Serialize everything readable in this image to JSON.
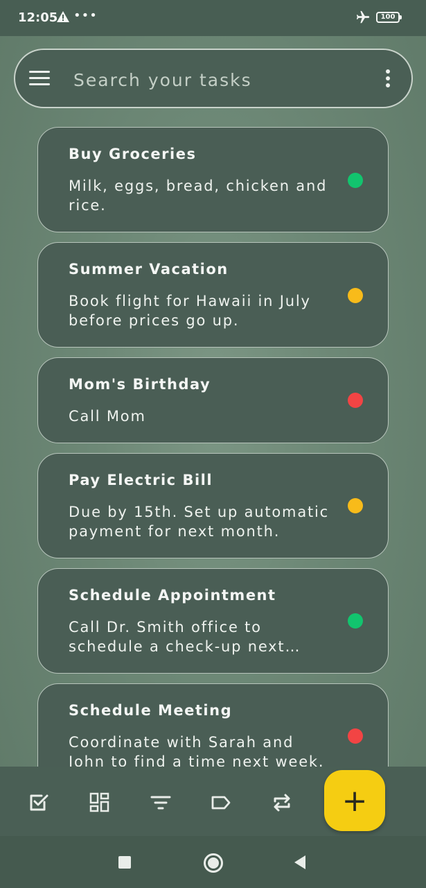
{
  "status_bar": {
    "time": "12:05",
    "more": "•••",
    "battery": "100",
    "icons": [
      "warning-icon",
      "airplane-icon",
      "battery-icon"
    ]
  },
  "search": {
    "placeholder": "Search your tasks",
    "value": ""
  },
  "tasks": [
    {
      "title": "Buy Groceries",
      "body": "Milk, eggs, bread, chicken and rice.",
      "priority": "low",
      "color": "#12c46e"
    },
    {
      "title": "Summer Vacation",
      "body": "Book flight for Hawaii in July before prices go up.",
      "priority": "medium",
      "color": "#f8bb1a"
    },
    {
      "title": "Mom's Birthday",
      "body": "Call Mom",
      "priority": "high",
      "color": "#f24444"
    },
    {
      "title": "Pay Electric Bill",
      "body": "Due by 15th. Set up automatic payment for next month.",
      "priority": "medium",
      "color": "#f8bb1a"
    },
    {
      "title": "Schedule Appointment",
      "body": "Call Dr. Smith office to schedule a check-up next month.",
      "priority": "low",
      "color": "#12c46e"
    },
    {
      "title": "Schedule Meeting",
      "body": "Coordinate with Sarah and John to find a time next week.",
      "priority": "high",
      "color": "#f24444"
    }
  ],
  "bottom_nav": {
    "items": [
      "tasks-icon",
      "dashboard-icon",
      "filter-icon",
      "label-icon",
      "repeat-icon"
    ],
    "fab": "+"
  },
  "colors": {
    "background": "#6d8876",
    "card": "#4a5e55",
    "fab": "#f5cd12"
  }
}
